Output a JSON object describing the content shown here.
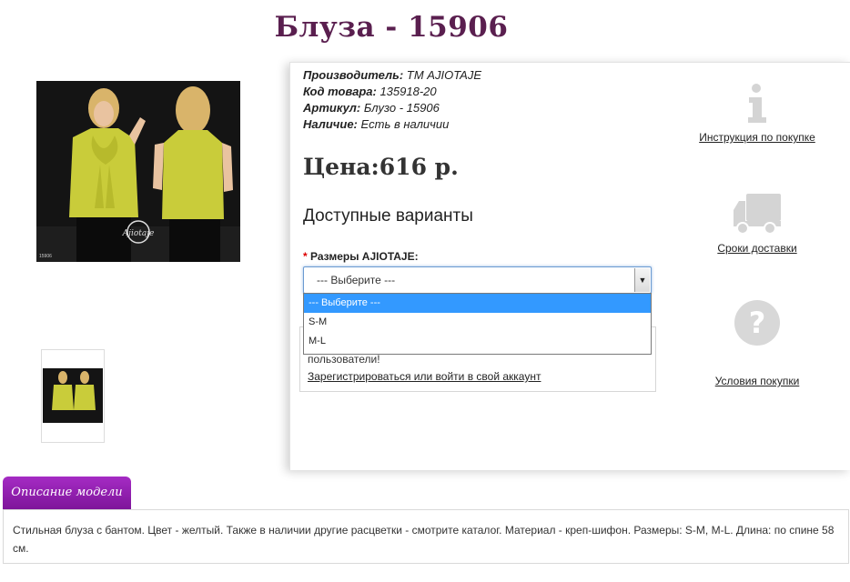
{
  "product": {
    "title": "Блуза - 15906",
    "image_caption": "15906"
  },
  "specs": {
    "manufacturer_label": "Производитель:",
    "manufacturer_value": " ТМ AJIOTAJE",
    "code_label": "Код товара:",
    "code_value": " 135918-20",
    "article_label": "Артикул:",
    "article_value": " Блузо - 15906",
    "stock_label": "Наличие:",
    "stock_value": " Есть в наличии"
  },
  "price": "Цена:616 р.",
  "variants": {
    "title": "Доступные варианты",
    "required_mark": "* ",
    "size_label": "Размеры AJIOTAJE:",
    "selected": "--- Выберите ---",
    "options": [
      "--- Выберите ---",
      "S-M",
      "M-L"
    ]
  },
  "login": {
    "message": "пользователи!",
    "link": "Зарегистрироваться или войти в свой аккаунт"
  },
  "side_links": {
    "instruction": "Инструкция по покупке",
    "delivery": "Сроки доставки",
    "terms": "Условия покупки"
  },
  "tabs": {
    "description_tab": "Описание модели"
  },
  "description": "Стильная блуза с бантом. Цвет - желтый. Также в наличии другие расцветки - смотрите каталог. Материал - креп-шифон. Размеры: S-M, M-L. Длина: по спине 58 см.",
  "colors": {
    "title": "#5a1f4f",
    "tab": "#8e1cad",
    "blouse": "#c9cc3a",
    "highlight": "#3399ff",
    "icon_gray": "#dcdcdc"
  },
  "icons": [
    "info-icon",
    "truck-icon",
    "question-icon",
    "dropdown-arrow-icon"
  ]
}
